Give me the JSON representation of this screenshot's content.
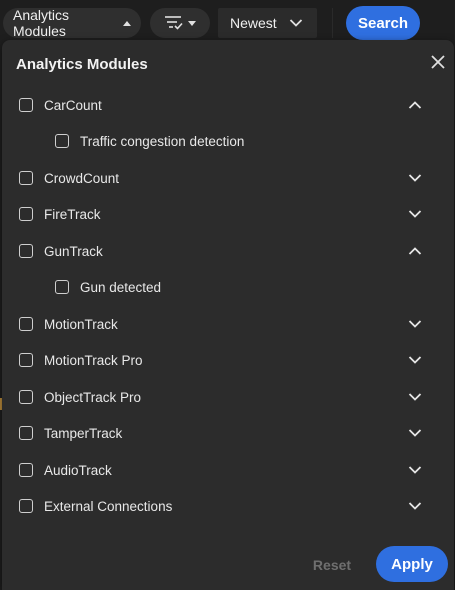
{
  "toolbar": {
    "modules_label": "Analytics Modules",
    "sort_label": "Newest",
    "search_label": "Search"
  },
  "panel": {
    "title": "Analytics Modules",
    "modules": [
      {
        "label": "CarCount",
        "expanded": true,
        "children": [
          "Traffic congestion detection"
        ]
      },
      {
        "label": "CrowdCount",
        "expanded": false,
        "children": []
      },
      {
        "label": "FireTrack",
        "expanded": false,
        "children": []
      },
      {
        "label": "GunTrack",
        "expanded": true,
        "children": [
          "Gun detected"
        ]
      },
      {
        "label": "MotionTrack",
        "expanded": false,
        "children": []
      },
      {
        "label": "MotionTrack Pro",
        "expanded": false,
        "children": []
      },
      {
        "label": "ObjectTrack Pro",
        "expanded": false,
        "children": []
      },
      {
        "label": "TamperTrack",
        "expanded": false,
        "children": []
      },
      {
        "label": "AudioTrack",
        "expanded": false,
        "children": []
      },
      {
        "label": "External Connections",
        "expanded": false,
        "children": []
      }
    ],
    "reset_label": "Reset",
    "apply_label": "Apply"
  },
  "colors": {
    "accent": "#2f6fe0",
    "panel_bg": "#2c2c2c",
    "page_bg": "#1e1e1e",
    "disabled_text": "#6f6f6f"
  },
  "icons": {
    "filter": "filter-lines-icon",
    "close": "close-icon",
    "expand": "chevron-down-icon",
    "collapse": "chevron-up-icon"
  }
}
